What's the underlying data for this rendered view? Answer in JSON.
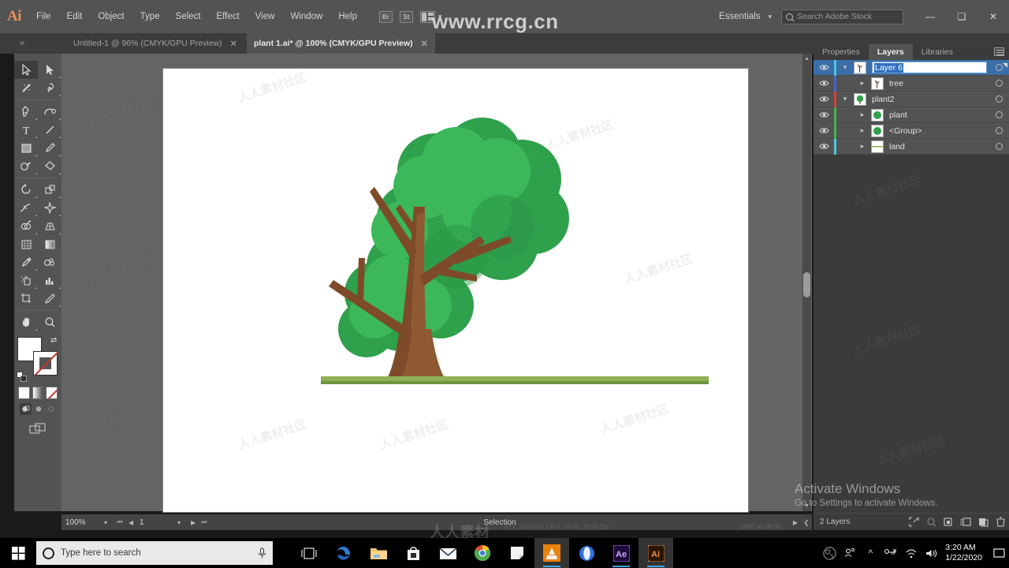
{
  "app": {
    "logo": "Ai",
    "watermark_top": "www.rrcg.cn",
    "menu": [
      "File",
      "Edit",
      "Object",
      "Type",
      "Select",
      "Effect",
      "View",
      "Window",
      "Help"
    ],
    "appbar_icons": [
      "Br",
      "St",
      "arrange-documents-icon"
    ],
    "workspace": "Essentials",
    "stock_search_placeholder": "Search Adobe Stock",
    "window_buttons": {
      "minimize": "—",
      "maximize": "❑",
      "close": "✕"
    }
  },
  "tabs": [
    {
      "label": "Untitled-1 @ 96% (CMYK/GPU Preview)",
      "close": "✕",
      "active": false
    },
    {
      "label": "plant 1.ai* @ 100% (CMYK/GPU Preview)",
      "close": "✕",
      "active": true
    }
  ],
  "tools": {
    "rows": [
      [
        "selection-tool",
        "direct-selection-tool"
      ],
      [
        "magic-wand-tool",
        "lasso-tool"
      ],
      [
        "pen-tool",
        "curvature-tool"
      ],
      [
        "type-tool",
        "line-segment-tool"
      ],
      [
        "rectangle-tool",
        "paintbrush-tool"
      ],
      [
        "shaper-tool",
        "eraser-tool"
      ],
      [
        "rotate-tool",
        "scale-tool"
      ],
      [
        "width-tool",
        "free-transform-tool"
      ],
      [
        "shape-builder-tool",
        "perspective-grid-tool"
      ],
      [
        "mesh-tool",
        "gradient-tool"
      ],
      [
        "eyedropper-tool",
        "blend-tool"
      ],
      [
        "symbol-sprayer-tool",
        "column-graph-tool"
      ],
      [
        "artboard-tool",
        "slice-tool"
      ],
      [
        "hand-tool",
        "zoom-tool"
      ]
    ],
    "selected": "selection-tool",
    "fill_color": "#ffffff",
    "stroke_color": "#ffffff",
    "mode_buttons": [
      "fill-color-button",
      "gradient-button",
      "none-button"
    ],
    "draw_buttons": [
      "draw-normal-button",
      "draw-behind-button",
      "draw-inside-button"
    ],
    "screen_mode": "change-screen-mode-button"
  },
  "artwork": {
    "title": "flat-tree-illustration",
    "colors": {
      "foliage_back": "#3aab55",
      "foliage_mid": "#2aa04a",
      "foliage_light": "#4ebd63",
      "trunk_dark": "#7b4a2a",
      "trunk_light": "#9a6238",
      "ground": "#8aad4a"
    }
  },
  "status": {
    "zoom": "100%",
    "page": "1",
    "tool": "Selection",
    "nav_first": "⏮",
    "nav_prev": "◀",
    "nav_next": "▶",
    "nav_last": "⏭"
  },
  "panel": {
    "tabs": [
      {
        "label": "Properties",
        "active": false
      },
      {
        "label": "Layers",
        "active": true
      },
      {
        "label": "Libraries",
        "active": false
      }
    ],
    "menu_icon": "panel-menu-icon",
    "layers": [
      {
        "name": "Layer 6",
        "editing": true,
        "selected": true,
        "indent": 0,
        "expanded": true,
        "color": "#4fc4e0",
        "thumb": "tree-thumbnail",
        "visible": true
      },
      {
        "name": "tree",
        "editing": false,
        "selected": false,
        "indent": 1,
        "expanded": false,
        "color": "#4b63c8",
        "thumb": "tree-thumbnail",
        "visible": true
      },
      {
        "name": "plant2",
        "editing": false,
        "selected": false,
        "indent": 0,
        "expanded": true,
        "color": "#d0423f",
        "thumb": "plant-thumbnail",
        "visible": true
      },
      {
        "name": "plant",
        "editing": false,
        "selected": false,
        "indent": 1,
        "expanded": false,
        "color": "#46b04a",
        "thumb": "plant-thumbnail",
        "visible": true
      },
      {
        "name": "<Group>",
        "editing": false,
        "selected": false,
        "indent": 1,
        "expanded": false,
        "color": "#46b04a",
        "thumb": "plant-thumbnail",
        "visible": true
      },
      {
        "name": "land",
        "editing": false,
        "selected": false,
        "indent": 1,
        "expanded": false,
        "color": "#4fc4e0",
        "thumb": "land-thumbnail",
        "visible": true
      }
    ],
    "footer": {
      "count": "2 Layers",
      "icons": [
        "locate-object-icon",
        "make-clipping-mask-icon",
        "create-new-sublayer-icon",
        "create-new-layer-icon",
        "delete-selection-icon"
      ]
    }
  },
  "overlays": {
    "activate_title": "Activate Windows",
    "activate_sub": "Go to Settings to activate Windows.",
    "site_watermark": "人人素材",
    "tile_watermark": "人人素材社区",
    "recorder_live": "LIVE 00:00:00",
    "recorder_rec": "REC 00:00:00     CH 0: 5% R; 30:00 fps"
  },
  "taskbar": {
    "start": "windows-start-icon",
    "search_placeholder": "Type here to search",
    "mic_icon": "microphone-icon",
    "taskview_icon": "task-view-icon",
    "apps": [
      "edge-icon",
      "file-explorer-icon",
      "microsoft-store-icon",
      "mail-icon",
      "chrome-icon",
      "sticky-notes-icon",
      "vlc-icon",
      "opera-icon",
      "after-effects-icon",
      "illustrator-icon"
    ],
    "tray": [
      "obs-icon",
      "people-icon",
      "show-hidden-icons-icon",
      "keyboard-icon",
      "wifi-icon",
      "volume-icon"
    ],
    "time": "3:20 AM",
    "date": "1/22/2020",
    "notifications": "action-center-icon"
  }
}
